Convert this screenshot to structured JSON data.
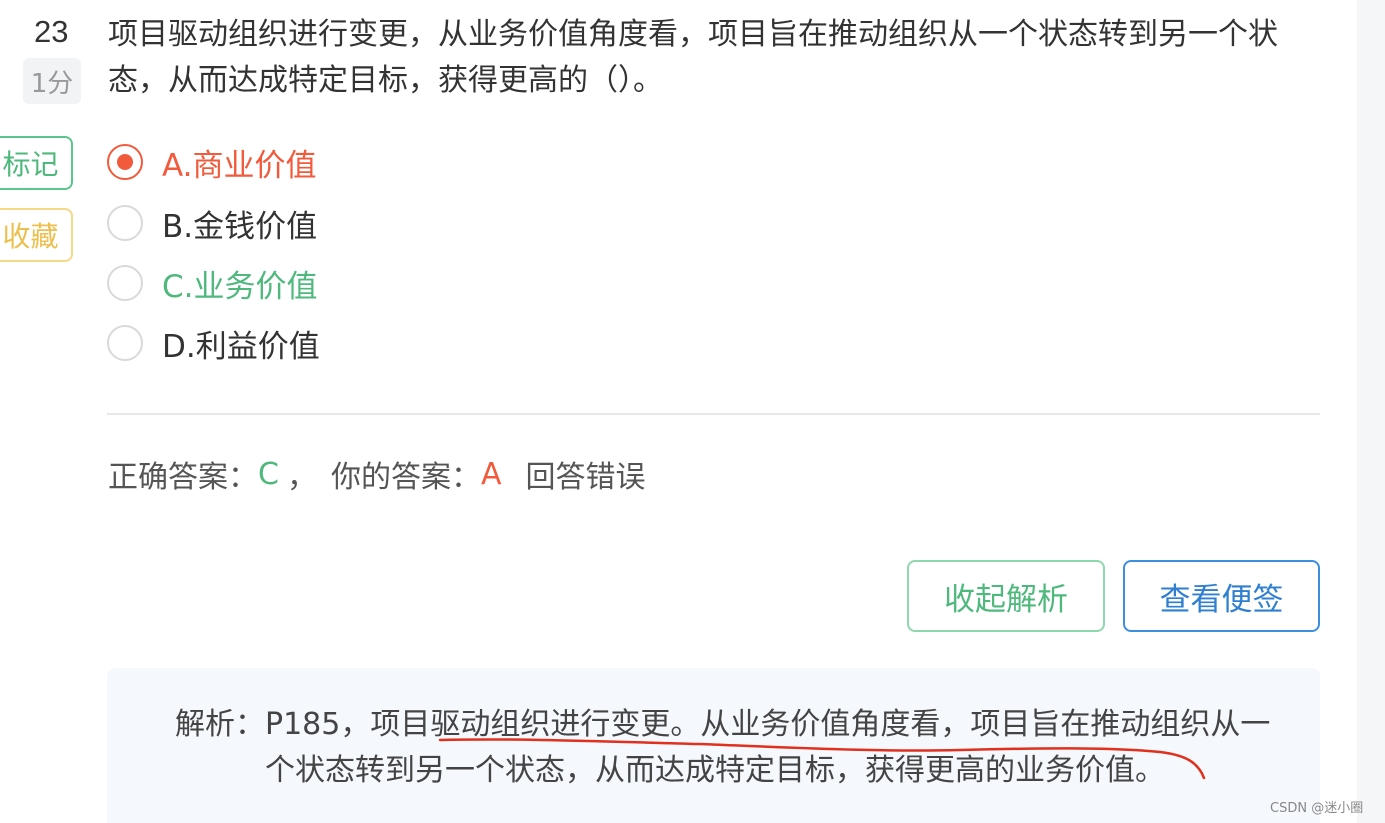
{
  "question": {
    "number": "23",
    "score": "1分",
    "stem": "项目驱动组织进行变更，从业务价值角度看，项目旨在推动组织从一个状态转到另一个状态，从而达成特定目标，获得更高的（）。"
  },
  "side_buttons": {
    "mark": "标记",
    "favorite": "收藏"
  },
  "options": [
    {
      "label": "A.商业价值",
      "selected": true,
      "state": "wrong"
    },
    {
      "label": "B.金钱价值",
      "selected": false,
      "state": "normal"
    },
    {
      "label": "C.业务价值",
      "selected": false,
      "state": "correct"
    },
    {
      "label": "D.利益价值",
      "selected": false,
      "state": "normal"
    }
  ],
  "result": {
    "correct_prefix": "正确答案：",
    "correct_answer": "C",
    "separator": "，",
    "your_prefix": "你的答案：",
    "your_answer": "A",
    "verdict": "回答错误"
  },
  "actions": {
    "collapse_analysis": "收起解析",
    "view_notes": "查看便签"
  },
  "analysis": {
    "text": "解析：P185，项目驱动组织进行变更。从业务价值角度看，项目旨在推动组织从一个状态转到另一个状态，从而达成特定目标，获得更高的业务价值。"
  },
  "watermark": "CSDN @迷小圈",
  "colors": {
    "correct": "#4fb97d",
    "wrong": "#f25a3c",
    "mark_border": "#5ac58c",
    "favorite_border": "#f6d889",
    "note_button": "#2f7fd0",
    "annotation_stroke": "#e0301e"
  }
}
